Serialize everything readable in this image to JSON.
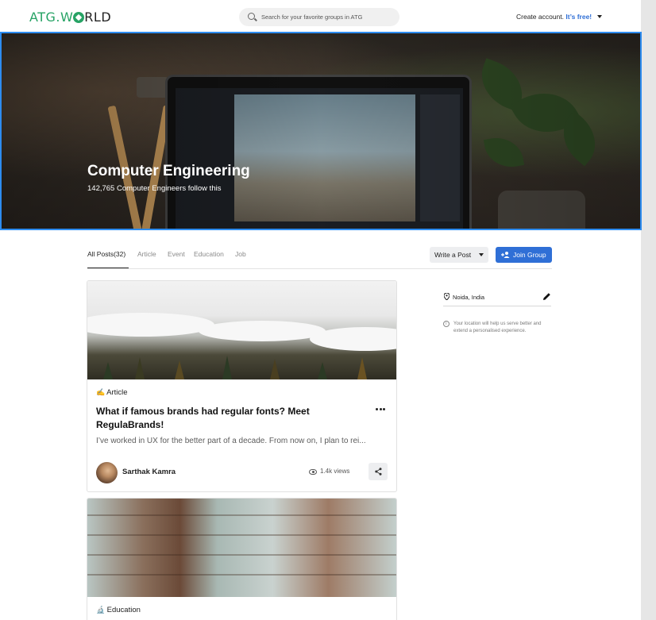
{
  "nav": {
    "logo": {
      "part1": "ATG.W",
      "part2": "RLD"
    },
    "search_placeholder": "Search for your favorite groups in ATG",
    "create_account": "Create account.",
    "free_text": "It’s free!"
  },
  "hero": {
    "title": "Computer Engineering",
    "subtitle": "142,765 Computer Engineers follow this"
  },
  "tabs": [
    {
      "label": "All Posts(32)",
      "active": true
    },
    {
      "label": "Article"
    },
    {
      "label": "Event"
    },
    {
      "label": "Education"
    },
    {
      "label": "Job"
    }
  ],
  "actions": {
    "write_post": "Write a Post",
    "join_group": "Join Group"
  },
  "posts": [
    {
      "type_emoji": "✍️",
      "type": "Article",
      "title": "What if famous brands had regular fonts? Meet RegulaBrands!",
      "excerpt": "I’ve worked in UX for the better part of a decade. From now on, I plan to rei...",
      "author": "Sarthak Kamra",
      "views": "1.4k views"
    },
    {
      "type_emoji": "🔬",
      "type": "Education"
    }
  ],
  "sidebar": {
    "location": "Noida, India",
    "location_note": "Your location will help us serve better and extend a personalised experience."
  },
  "colors": {
    "brand_green": "#27a365",
    "accent_blue": "#2f6fd6",
    "hero_border": "#2d8cf0"
  }
}
